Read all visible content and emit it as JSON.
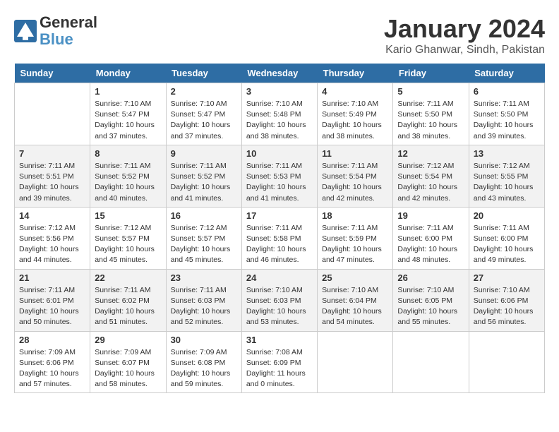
{
  "logo": {
    "line1": "General",
    "line2": "Blue"
  },
  "title": "January 2024",
  "location": "Kario Ghanwar, Sindh, Pakistan",
  "weekdays": [
    "Sunday",
    "Monday",
    "Tuesday",
    "Wednesday",
    "Thursday",
    "Friday",
    "Saturday"
  ],
  "weeks": [
    [
      {
        "day": "",
        "empty": true
      },
      {
        "day": "1",
        "sunrise": "7:10 AM",
        "sunset": "5:47 PM",
        "daylight": "10 hours and 37 minutes."
      },
      {
        "day": "2",
        "sunrise": "7:10 AM",
        "sunset": "5:47 PM",
        "daylight": "10 hours and 37 minutes."
      },
      {
        "day": "3",
        "sunrise": "7:10 AM",
        "sunset": "5:48 PM",
        "daylight": "10 hours and 38 minutes."
      },
      {
        "day": "4",
        "sunrise": "7:10 AM",
        "sunset": "5:49 PM",
        "daylight": "10 hours and 38 minutes."
      },
      {
        "day": "5",
        "sunrise": "7:11 AM",
        "sunset": "5:50 PM",
        "daylight": "10 hours and 38 minutes."
      },
      {
        "day": "6",
        "sunrise": "7:11 AM",
        "sunset": "5:50 PM",
        "daylight": "10 hours and 39 minutes."
      }
    ],
    [
      {
        "day": "7",
        "sunrise": "7:11 AM",
        "sunset": "5:51 PM",
        "daylight": "10 hours and 39 minutes."
      },
      {
        "day": "8",
        "sunrise": "7:11 AM",
        "sunset": "5:52 PM",
        "daylight": "10 hours and 40 minutes."
      },
      {
        "day": "9",
        "sunrise": "7:11 AM",
        "sunset": "5:52 PM",
        "daylight": "10 hours and 41 minutes."
      },
      {
        "day": "10",
        "sunrise": "7:11 AM",
        "sunset": "5:53 PM",
        "daylight": "10 hours and 41 minutes."
      },
      {
        "day": "11",
        "sunrise": "7:11 AM",
        "sunset": "5:54 PM",
        "daylight": "10 hours and 42 minutes."
      },
      {
        "day": "12",
        "sunrise": "7:12 AM",
        "sunset": "5:54 PM",
        "daylight": "10 hours and 42 minutes."
      },
      {
        "day": "13",
        "sunrise": "7:12 AM",
        "sunset": "5:55 PM",
        "daylight": "10 hours and 43 minutes."
      }
    ],
    [
      {
        "day": "14",
        "sunrise": "7:12 AM",
        "sunset": "5:56 PM",
        "daylight": "10 hours and 44 minutes."
      },
      {
        "day": "15",
        "sunrise": "7:12 AM",
        "sunset": "5:57 PM",
        "daylight": "10 hours and 45 minutes."
      },
      {
        "day": "16",
        "sunrise": "7:12 AM",
        "sunset": "5:57 PM",
        "daylight": "10 hours and 45 minutes."
      },
      {
        "day": "17",
        "sunrise": "7:11 AM",
        "sunset": "5:58 PM",
        "daylight": "10 hours and 46 minutes."
      },
      {
        "day": "18",
        "sunrise": "7:11 AM",
        "sunset": "5:59 PM",
        "daylight": "10 hours and 47 minutes."
      },
      {
        "day": "19",
        "sunrise": "7:11 AM",
        "sunset": "6:00 PM",
        "daylight": "10 hours and 48 minutes."
      },
      {
        "day": "20",
        "sunrise": "7:11 AM",
        "sunset": "6:00 PM",
        "daylight": "10 hours and 49 minutes."
      }
    ],
    [
      {
        "day": "21",
        "sunrise": "7:11 AM",
        "sunset": "6:01 PM",
        "daylight": "10 hours and 50 minutes."
      },
      {
        "day": "22",
        "sunrise": "7:11 AM",
        "sunset": "6:02 PM",
        "daylight": "10 hours and 51 minutes."
      },
      {
        "day": "23",
        "sunrise": "7:11 AM",
        "sunset": "6:03 PM",
        "daylight": "10 hours and 52 minutes."
      },
      {
        "day": "24",
        "sunrise": "7:10 AM",
        "sunset": "6:03 PM",
        "daylight": "10 hours and 53 minutes."
      },
      {
        "day": "25",
        "sunrise": "7:10 AM",
        "sunset": "6:04 PM",
        "daylight": "10 hours and 54 minutes."
      },
      {
        "day": "26",
        "sunrise": "7:10 AM",
        "sunset": "6:05 PM",
        "daylight": "10 hours and 55 minutes."
      },
      {
        "day": "27",
        "sunrise": "7:10 AM",
        "sunset": "6:06 PM",
        "daylight": "10 hours and 56 minutes."
      }
    ],
    [
      {
        "day": "28",
        "sunrise": "7:09 AM",
        "sunset": "6:06 PM",
        "daylight": "10 hours and 57 minutes."
      },
      {
        "day": "29",
        "sunrise": "7:09 AM",
        "sunset": "6:07 PM",
        "daylight": "10 hours and 58 minutes."
      },
      {
        "day": "30",
        "sunrise": "7:09 AM",
        "sunset": "6:08 PM",
        "daylight": "10 hours and 59 minutes."
      },
      {
        "day": "31",
        "sunrise": "7:08 AM",
        "sunset": "6:09 PM",
        "daylight": "11 hours and 0 minutes."
      },
      {
        "day": "",
        "empty": true
      },
      {
        "day": "",
        "empty": true
      },
      {
        "day": "",
        "empty": true
      }
    ]
  ]
}
